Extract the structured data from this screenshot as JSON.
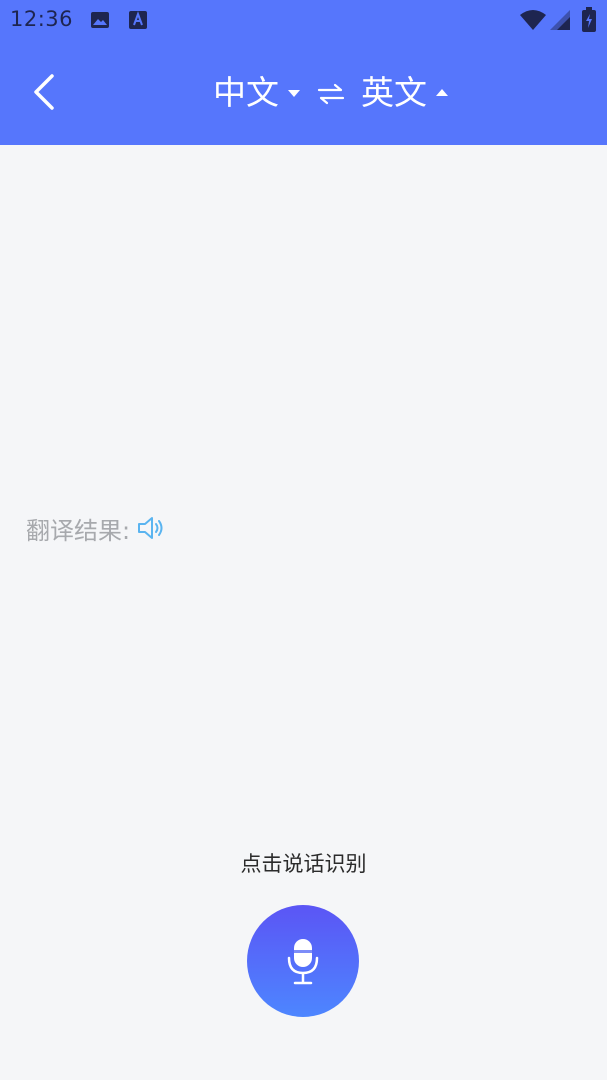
{
  "status_bar": {
    "time": "12:36",
    "icons": [
      "image-icon",
      "a-letter-icon",
      "wifi-icon",
      "signal-icon",
      "battery-icon"
    ]
  },
  "toolbar": {
    "back_icon": "chevron-left-icon",
    "source_language": "中文",
    "target_language": "英文",
    "swap_icon": "swap-arrows-icon",
    "source_caret": "caret-down-icon",
    "target_caret": "caret-up-icon"
  },
  "result": {
    "label": "翻译结果:",
    "speaker_icon": "speaker-icon"
  },
  "voice": {
    "hint": "点击说话识别",
    "mic_icon": "microphone-icon"
  },
  "colors": {
    "primary": "#5676fc",
    "background": "#f5f6f8",
    "label_gray": "#a7a9ad",
    "speaker_blue": "#5ab4f0",
    "mic_gradient_top": "#5b55f5",
    "mic_gradient_bottom": "#4d86ff"
  }
}
